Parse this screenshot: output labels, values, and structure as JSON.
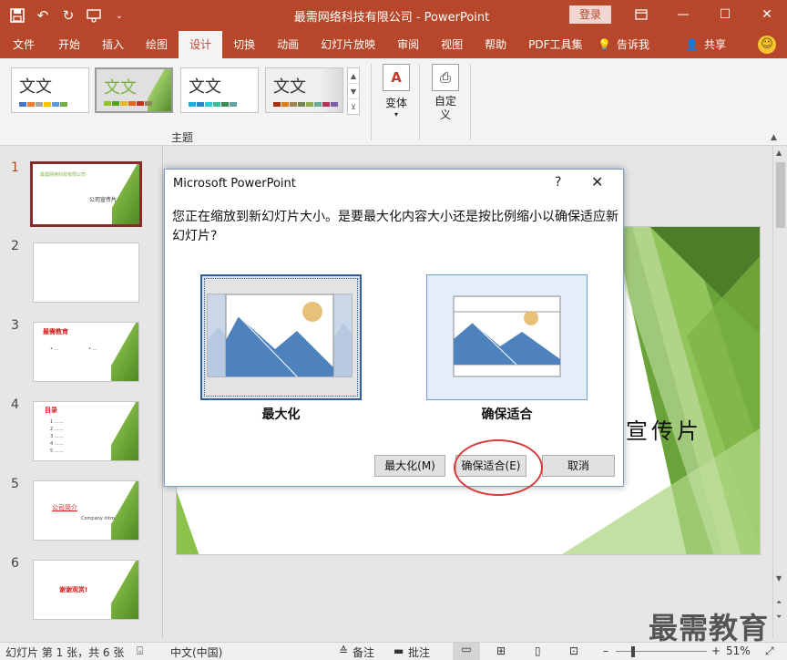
{
  "window": {
    "title": "最需网络科技有限公司  -  PowerPoint",
    "login_label": "登录"
  },
  "ribbon": {
    "tabs": [
      "文件",
      "开始",
      "插入",
      "绘图",
      "设计",
      "切换",
      "动画",
      "幻灯片放映",
      "审阅",
      "视图",
      "帮助",
      "PDF工具集"
    ],
    "active_tab": "设计",
    "tell_me": "告诉我",
    "share": "共享",
    "theme_group_label": "主题",
    "theme_sample_text": "文文",
    "variants_label": "变体",
    "customize_label": "自定义",
    "colors": {
      "bar_red": "#b7472a",
      "accent_green": "#7cb342"
    }
  },
  "thumbnails": {
    "items": [
      {
        "num": "1",
        "title": "最需网络科技有限公司",
        "subtitle": "公司宣传片"
      },
      {
        "num": "2",
        "title": "",
        "subtitle": ""
      },
      {
        "num": "3",
        "title": "最需教育",
        "subtitle": ""
      },
      {
        "num": "4",
        "title": "目录",
        "subtitle": ""
      },
      {
        "num": "5",
        "title": "公司简介",
        "subtitle": "Company introduction"
      },
      {
        "num": "6",
        "title": "谢谢观赏!",
        "subtitle": ""
      }
    ]
  },
  "slide": {
    "visible_text": "宣传片"
  },
  "dialog": {
    "title": "Microsoft PowerPoint",
    "help": "?",
    "message": "您正在缩放到新幻灯片大小。是要最大化内容大小还是按比例缩小以确保适应新幻灯片?",
    "option_maximize": "最大化",
    "option_fit": "确保适合",
    "btn_maximize": "最大化(M)",
    "btn_fit": "确保适合(E)",
    "btn_cancel": "取消"
  },
  "status": {
    "slide_info": "幻灯片 第 1 张，共 6 张",
    "language": "中文(中国)",
    "notes": "备注",
    "comments": "批注",
    "zoom": "51%"
  },
  "watermark": "最需教育"
}
